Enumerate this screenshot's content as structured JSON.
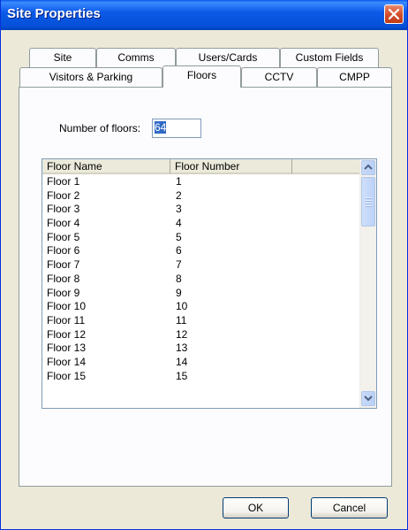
{
  "window": {
    "title": "Site Properties"
  },
  "tabs": {
    "row1": [
      {
        "label": "Site"
      },
      {
        "label": "Comms"
      },
      {
        "label": "Users/Cards"
      },
      {
        "label": "Custom Fields"
      }
    ],
    "row2": [
      {
        "label": "Visitors & Parking"
      },
      {
        "label": "Floors",
        "selected": true
      },
      {
        "label": "CCTV"
      },
      {
        "label": "CMPP"
      }
    ]
  },
  "floors_panel": {
    "number_of_floors_label": "Number of floors:",
    "number_of_floors_value": "64",
    "columns": [
      "Floor Name",
      "Floor Number"
    ],
    "rows": [
      {
        "name": "Floor 1",
        "number": "1"
      },
      {
        "name": "Floor 2",
        "number": "2"
      },
      {
        "name": "Floor 3",
        "number": "3"
      },
      {
        "name": "Floor 4",
        "number": "4"
      },
      {
        "name": "Floor 5",
        "number": "5"
      },
      {
        "name": "Floor 6",
        "number": "6"
      },
      {
        "name": "Floor 7",
        "number": "7"
      },
      {
        "name": "Floor 8",
        "number": "8"
      },
      {
        "name": "Floor 9",
        "number": "9"
      },
      {
        "name": "Floor 10",
        "number": "10"
      },
      {
        "name": "Floor 11",
        "number": "11"
      },
      {
        "name": "Floor 12",
        "number": "12"
      },
      {
        "name": "Floor 13",
        "number": "13"
      },
      {
        "name": "Floor 14",
        "number": "14"
      },
      {
        "name": "Floor 15",
        "number": "15"
      }
    ]
  },
  "buttons": {
    "ok": "OK",
    "cancel": "Cancel"
  },
  "icons": {
    "close": "close-icon",
    "scroll_up": "chevron-up-icon",
    "scroll_down": "chevron-down-icon"
  },
  "colors": {
    "titlebar": "#0a58e8",
    "window_bg": "#ece9d8",
    "selection": "#316ac5",
    "close_button": "#d4502c"
  }
}
